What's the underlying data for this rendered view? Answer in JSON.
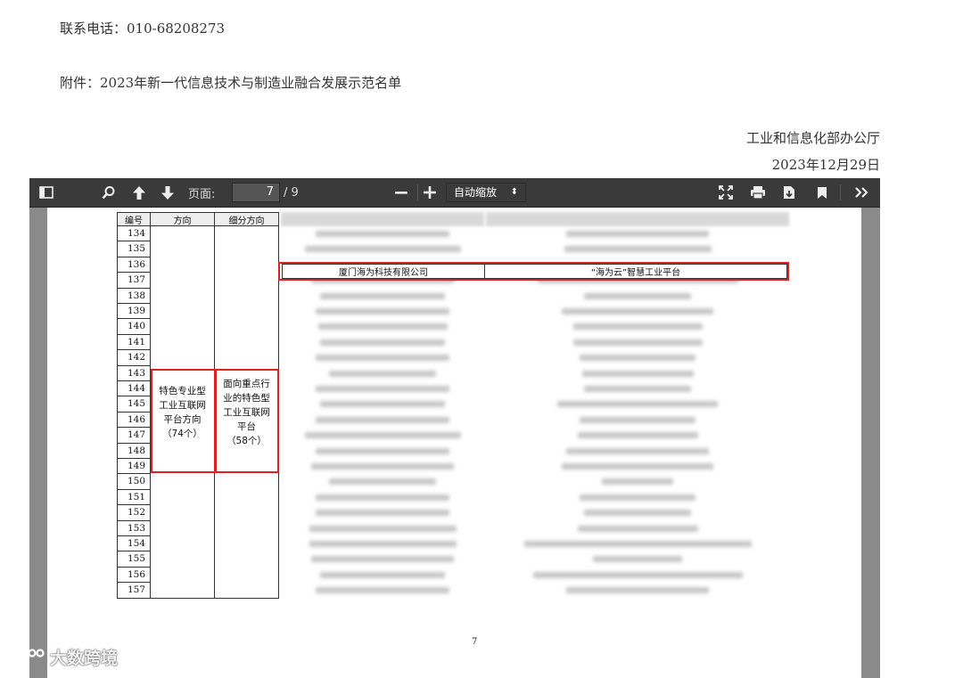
{
  "document": {
    "contact": "联系电话：010-68208273",
    "attachment": "附件：2023年新一代信息技术与制造业融合发展示范名单",
    "issuer": "工业和信息化部办公厅",
    "date": "2023年12月29日"
  },
  "toolbar": {
    "page_label": "页面:",
    "page_value": "7",
    "page_total": "/ 9",
    "zoom": "自动缩放",
    "icons": [
      "sidebar-toggle-icon",
      "search-icon",
      "up-arrow-icon",
      "down-arrow-icon",
      "minus-icon",
      "plus-icon",
      "fullscreen-icon",
      "print-icon",
      "download-icon",
      "bookmark-icon",
      "more-icon"
    ]
  },
  "table": {
    "headers": [
      "编号",
      "方向",
      "细分方向"
    ],
    "numbers": [
      "134",
      "135",
      "136",
      "137",
      "138",
      "139",
      "140",
      "141",
      "142",
      "143",
      "144",
      "145",
      "146",
      "147",
      "148",
      "149",
      "150",
      "151",
      "152",
      "153",
      "154",
      "155",
      "156",
      "157"
    ],
    "direction": [
      "特色专业型",
      "工业互联网",
      "平台方向",
      "（74个）"
    ],
    "sub_direction": [
      "面向重点行",
      "业的特色型",
      "工业互联网",
      "平台",
      "（58个）"
    ],
    "highlight_row": {
      "company": "厦门海为科技有限公司",
      "platform": "“海为云”智慧工业平台"
    }
  },
  "page_number": "7",
  "watermark": "大数跨境"
}
